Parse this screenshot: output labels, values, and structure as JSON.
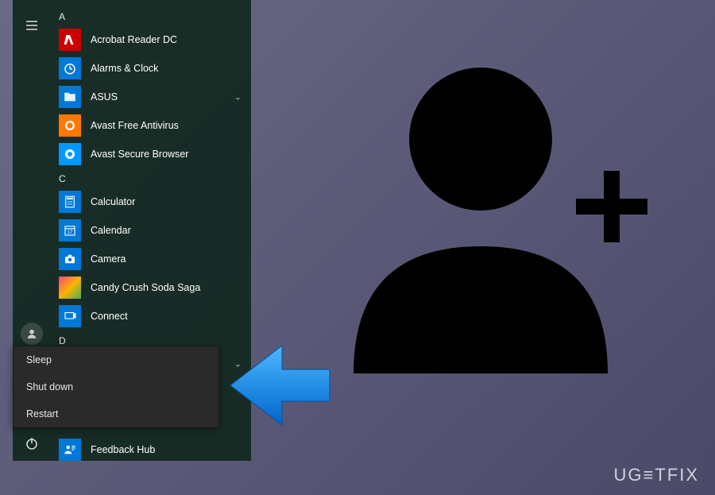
{
  "rail": {
    "hamburger": "menu-icon",
    "user": "user-icon",
    "documents": "documents-icon",
    "power": "power-icon"
  },
  "sections": {
    "A": {
      "letter": "A",
      "items": [
        {
          "label": "Acrobat Reader DC",
          "icon": "adobe",
          "expandable": false
        },
        {
          "label": "Alarms & Clock",
          "icon": "alarm",
          "expandable": false
        },
        {
          "label": "ASUS",
          "icon": "asus",
          "expandable": true
        },
        {
          "label": "Avast Free Antivirus",
          "icon": "avast",
          "expandable": false
        },
        {
          "label": "Avast Secure Browser",
          "icon": "avast2",
          "expandable": false
        }
      ]
    },
    "C": {
      "letter": "C",
      "items": [
        {
          "label": "Calculator",
          "icon": "calc",
          "expandable": false
        },
        {
          "label": "Calendar",
          "icon": "cal",
          "expandable": false
        },
        {
          "label": "Camera",
          "icon": "cam",
          "expandable": false
        },
        {
          "label": "Candy Crush Soda Saga",
          "icon": "candy",
          "expandable": false
        },
        {
          "label": "Connect",
          "icon": "connect",
          "expandable": false
        }
      ]
    },
    "D": {
      "letter": "D",
      "items": [
        {
          "label": "",
          "icon": "",
          "expandable": true
        },
        {
          "label": "Feedback Hub",
          "icon": "fb",
          "expandable": false
        }
      ]
    }
  },
  "power_menu": {
    "sleep": "Sleep",
    "shutdown": "Shut down",
    "restart": "Restart"
  },
  "watermark": "UG≡TFIX"
}
